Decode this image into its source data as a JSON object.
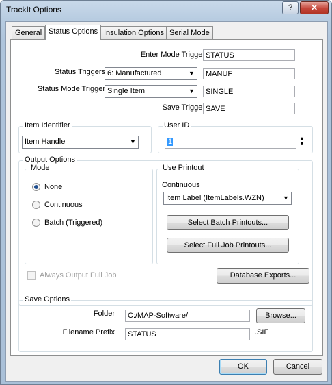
{
  "window": {
    "title": "TrackIt Options",
    "help_icon": "?",
    "close_icon": "✕"
  },
  "tabs": [
    {
      "label": "General"
    },
    {
      "label": "Status Options"
    },
    {
      "label": "Insulation Options"
    },
    {
      "label": "Serial Mode"
    }
  ],
  "triggers": {
    "enter_mode_label": "Enter Mode Trigger",
    "enter_mode_value": "STATUS",
    "status_triggers_label": "Status Triggers",
    "status_triggers_selected": "6: Manufactured",
    "status_triggers_value": "MANUF",
    "status_mode_label": "Status Mode Trigger",
    "status_mode_selected": "Single Item",
    "status_mode_value": "SINGLE",
    "save_label": "Save Trigger",
    "save_value": "SAVE"
  },
  "item_identifier": {
    "title": "Item Identifier",
    "selected": "Item Handle"
  },
  "user_id": {
    "title": "User ID",
    "value": "1"
  },
  "output_options": {
    "title": "Output Options",
    "mode": {
      "title": "Mode",
      "options": [
        {
          "label": "None",
          "checked": true
        },
        {
          "label": "Continuous",
          "checked": false
        },
        {
          "label": "Batch (Triggered)",
          "checked": false
        }
      ]
    },
    "use_printout": {
      "title": "Use Printout",
      "continuous_label": "Continuous",
      "continuous_selected": "Item Label (ItemLabels.WZN)",
      "batch_button": "Select Batch Printouts...",
      "full_job_button": "Select Full Job Printouts..."
    },
    "always_output_label": "Always Output Full Job",
    "database_exports_button": "Database Exports..."
  },
  "save_options": {
    "title": "Save Options",
    "folder_label": "Folder",
    "folder_value": "C:/MAP-Software/",
    "browse_button": "Browse...",
    "prefix_label": "Filename Prefix",
    "prefix_value": "STATUS",
    "extension": ".SIF"
  },
  "footer": {
    "ok": "OK",
    "cancel": "Cancel"
  }
}
